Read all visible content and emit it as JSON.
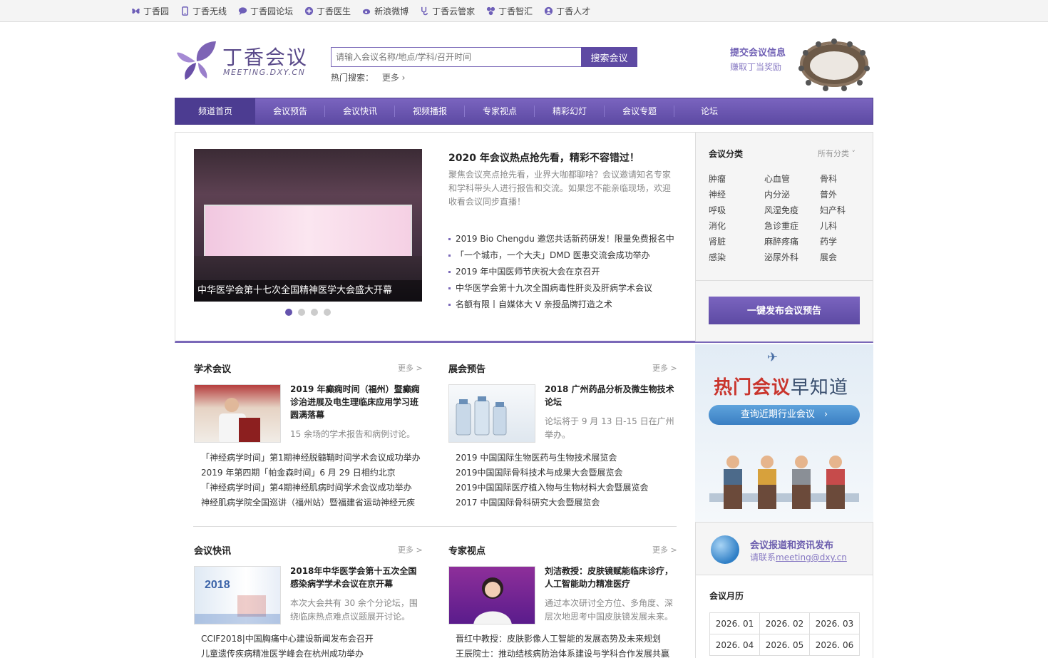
{
  "topbar": {
    "links": [
      {
        "label": "丁香园",
        "icon": "butterfly-icon",
        "color": "#6e5fb8"
      },
      {
        "label": "丁香无线",
        "icon": "phone-icon",
        "color": "#6e5fb8"
      },
      {
        "label": "丁香园论坛",
        "icon": "chat-icon",
        "color": "#6e5fb8"
      },
      {
        "label": "丁香医生",
        "icon": "plus-icon",
        "color": "#6e5fb8"
      },
      {
        "label": "新浪微博",
        "icon": "weibo-icon",
        "color": "#6e5fb8"
      },
      {
        "label": "丁香云管家",
        "icon": "stethoscope-icon",
        "color": "#6e5fb8"
      },
      {
        "label": "丁香智汇",
        "icon": "puzzle-icon",
        "color": "#6e5fb8"
      },
      {
        "label": "丁香人才",
        "icon": "person-icon",
        "color": "#6e5fb8"
      }
    ]
  },
  "header": {
    "logo_cn": "丁香会议",
    "logo_en": "MEETING.DXY.CN",
    "search_placeholder": "请输入会议名称/地点/学科/召开时间",
    "search_button": "搜索会议",
    "hot_label": "热门搜索：",
    "hot_more": "更多 ›",
    "submit_title": "提交会议信息",
    "submit_sub": "赚取丁当奖励"
  },
  "nav": [
    "频道首页",
    "会议预告",
    "会议快讯",
    "视频播报",
    "专家视点",
    "精彩幻灯",
    "会议专题",
    "论坛"
  ],
  "featured": {
    "slide_caption": "中华医学会第十七次全国精神医学大会盛大开幕",
    "title": "2020 年会议热点抢先看，精彩不容错过！",
    "desc": "聚焦会议亮点抢先看，业界大咖都聊啥？会议邀请知名专家和学科带头人进行报告和交流。如果您不能亲临现场，欢迎收看会议同步直播！",
    "items": [
      "2019 Bio Chengdu 邀您共话新药研发！限量免费报名中",
      "「一个城市，一个大夫」DMD 医患交流会成功举办",
      "2019 年中国医师节庆祝大会在京召开",
      "中华医学会第十九次全国病毒性肝炎及肝病学术会议",
      "名额有限丨自媒体大 V 亲授品牌打造之术"
    ]
  },
  "categories": {
    "title": "会议分类",
    "all": "所有分类 ˅",
    "items": [
      "肿瘤",
      "心血管",
      "骨科",
      "神经",
      "内分泌",
      "普外",
      "呼吸",
      "风湿免疫",
      "妇产科",
      "消化",
      "急诊重症",
      "儿科",
      "肾脏",
      "麻醉疼痛",
      "药学",
      "感染",
      "泌尿外科",
      "展会"
    ],
    "publish_button": "一键发布会议预告"
  },
  "sections": {
    "academic": {
      "title": "学术会议",
      "more": "更多 >",
      "card_title": "2019 年癫痫时间（福州）暨癫痫诊治进展及电生理临床应用学习班圆满落幕",
      "card_desc": "15 余场的学术报告和病例讨论。",
      "list": [
        "「神经病学时间」第1期神经脱髓鞘时间学术会议成功举办",
        "2019 年第四期「帕金森时间」6 月 29 日相约北京",
        "「神经病学时间」第4期神经肌病时间学术会议成功举办",
        "神经肌病学院全国巡讲（福州站）暨福建省运动神经元疾"
      ]
    },
    "expo": {
      "title": "展会预告",
      "more": "更多 >",
      "card_title": "2018 广州药品分析及微生物技术论坛",
      "card_desc": "论坛将于 9 月 13 日-15 日在广州举办。",
      "list": [
        "2019 中国国际生物医药与生物技术展览会",
        "2019中国国际骨科技术与成果大会暨展览会",
        "2019中国国际医疗植入物与生物材料大会暨展览会",
        "2017 中国国际骨科研究大会暨展览会"
      ]
    },
    "news": {
      "title": "会议快讯",
      "more": "更多 >",
      "card_title": "2018年中华医学会第十五次全国感染病学学术会议在京开幕",
      "card_desc": "本次大会共有 30 余个分论坛，围绕临床热点难点议题展开讨论。",
      "list": [
        "CCIF2018|中国胸痛中心建设新闻发布会召开",
        "儿童遗传疾病精准医学峰会在杭州成功举办"
      ]
    },
    "expert": {
      "title": "专家视点",
      "more": "更多 >",
      "card_title": "刘洁教授：皮肤镜赋能临床诊疗，人工智能助力精准医疗",
      "card_desc": "通过本次研讨全方位、多角度、深层次地思考中国皮肤镜发展未来。",
      "list": [
        "晋红中教授：皮肤影像人工智能的发展态势及未来规划",
        "王辰院士：推动结核病防治体系建设与学科合作发展共赢"
      ]
    }
  },
  "promo": {
    "title_red": "热门会议",
    "title_dark": "早知道",
    "button": "查询近期行业会议　›"
  },
  "report": {
    "title": "会议报道和资讯发布",
    "contact_prefix": "请联系",
    "email": "meeting@dxy.cn"
  },
  "monthly": {
    "title": "会议月历",
    "months": [
      [
        "2026. 01",
        "2026. 02",
        "2026. 03"
      ],
      [
        "2026. 04",
        "2026. 05",
        "2026. 06"
      ]
    ]
  }
}
